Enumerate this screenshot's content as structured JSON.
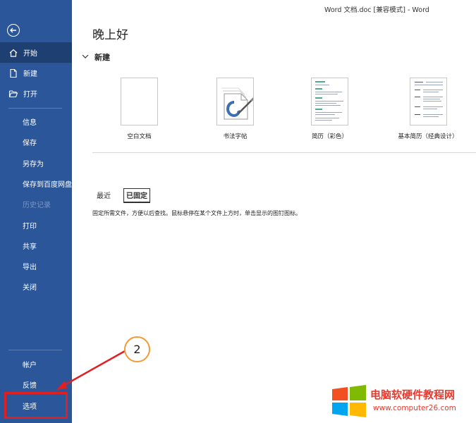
{
  "window": {
    "title": "Word 文档.doc [兼容模式]  -  Word"
  },
  "sidebar": {
    "back_icon": "back-arrow-icon",
    "items": [
      {
        "label": "开始",
        "icon": "home-icon",
        "active": true
      },
      {
        "label": "新建",
        "icon": "new-document-icon"
      },
      {
        "label": "打开",
        "icon": "open-folder-icon"
      },
      {
        "label": "信息"
      },
      {
        "label": "保存"
      },
      {
        "label": "另存为"
      },
      {
        "label": "保存到百度网盘"
      },
      {
        "label": "历史记录",
        "disabled": true
      },
      {
        "label": "打印"
      },
      {
        "label": "共享"
      },
      {
        "label": "导出"
      },
      {
        "label": "关闭"
      },
      {
        "label": "帐户"
      },
      {
        "label": "反馈"
      },
      {
        "label": "选项"
      }
    ],
    "color": "#2b579a"
  },
  "main": {
    "greeting": "晚上好",
    "new_section": {
      "title": "新建"
    },
    "templates": [
      {
        "label": "空白文档"
      },
      {
        "label": "书法字帖"
      },
      {
        "label": "简历（彩色）"
      },
      {
        "label": "基本简历（经典设计）"
      }
    ],
    "tabs": [
      {
        "label": "最近"
      },
      {
        "label": "已固定",
        "active": true
      }
    ],
    "pinned_hint": "固定所需文件，方便以后查找。鼠标悬停在某个文件上方时，单击显示的图钉图标。"
  },
  "annotation": {
    "step_number": "2",
    "highlight_color": "#e02020",
    "circle_color": "#f39a3a"
  },
  "watermark": {
    "title": "电脑软硬件教程网",
    "url": "www.computer26.com"
  }
}
